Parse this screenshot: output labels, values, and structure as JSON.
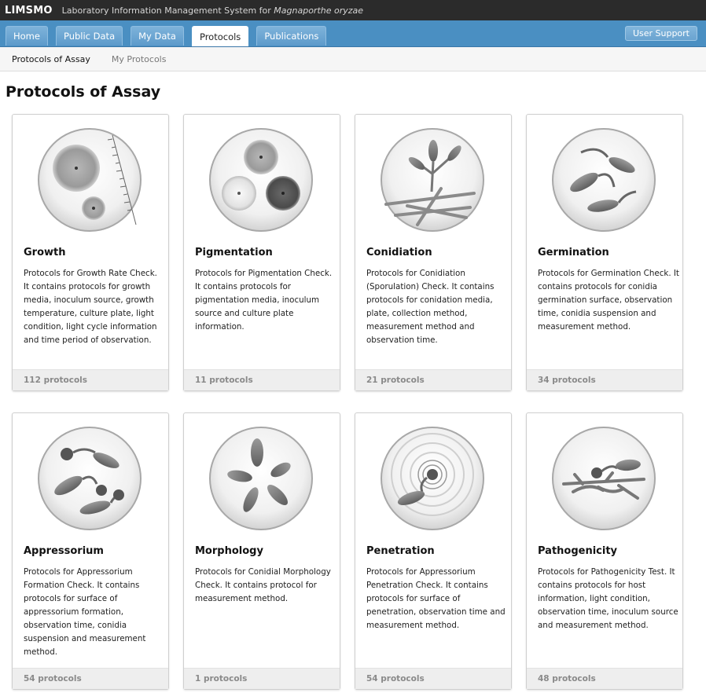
{
  "app": {
    "brand": "LIMSMO",
    "subtitle_prefix": "Laboratory Information Management System for",
    "subtitle_species": "Magnaporthe oryzae"
  },
  "nav": {
    "tabs": [
      "Home",
      "Public Data",
      "My Data",
      "Protocols",
      "Publications"
    ],
    "active_tab": "Protocols",
    "support_label": "User Support"
  },
  "subnav": {
    "items": [
      "Protocols of Assay",
      "My Protocols"
    ],
    "active": "Protocols of Assay"
  },
  "page_title": "Protocols of Assay",
  "cards": [
    {
      "title": "Growth",
      "icon": "growth-plate-icon",
      "description": "Protocols for Growth Rate Check. It contains protocols for growth media, inoculum source, growth temperature, culture plate, light condition, light cycle information and time period of observation.",
      "count": "112 protocols"
    },
    {
      "title": "Pigmentation",
      "icon": "pigmentation-plate-icon",
      "description": "Protocols for Pigmentation Check. It contains protocols for pigmentation media, inoculum source and culture plate information.",
      "count": "11 protocols"
    },
    {
      "title": "Conidiation",
      "icon": "conidiation-icon",
      "description": "Protocols for Conidiation (Sporulation) Check. It contains protocols for conidation media, plate, collection method, measurement method and observation time.",
      "count": "21 protocols"
    },
    {
      "title": "Germination",
      "icon": "germination-icon",
      "description": "Protocols for Germination Check. It contains protocols for conidia germination surface, observation time, conidia suspension and measurement method.",
      "count": "34 protocols"
    },
    {
      "title": "Appressorium",
      "icon": "appressorium-icon",
      "description": "Protocols for Appressorium Formation Check. It contains protocols for surface of appressorium formation, observation time, conidia suspension and measurement method.",
      "count": "54 protocols"
    },
    {
      "title": "Morphology",
      "icon": "morphology-icon",
      "description": "Protocols for Conidial Morphology Check. It contains protocol for measurement method.",
      "count": "1 protocols"
    },
    {
      "title": "Penetration",
      "icon": "penetration-icon",
      "description": "Protocols for Appressorium Penetration Check. It contains protocols for surface of penetration, observation time and measurement method.",
      "count": "54 protocols"
    },
    {
      "title": "Pathogenicity",
      "icon": "pathogenicity-icon",
      "description": "Protocols for Pathogenicity Test. It contains protocols for host information, light condition, observation time, inoculum source and measurement method.",
      "count": "48 protocols"
    }
  ]
}
